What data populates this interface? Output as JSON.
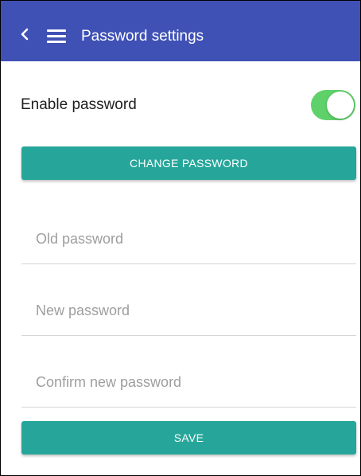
{
  "header": {
    "title": "Password settings",
    "back_icon": "chevron-left-icon",
    "menu_icon": "hamburger-menu-icon",
    "background_color": "#3f51b5"
  },
  "enable_password": {
    "label": "Enable password",
    "enabled": true,
    "toggle_color": "#5fd16a"
  },
  "change_password_button": {
    "label": "CHANGE PASSWORD"
  },
  "fields": {
    "old_password": {
      "placeholder": "Old password",
      "value": ""
    },
    "new_password": {
      "placeholder": "New password",
      "value": ""
    },
    "confirm_password": {
      "placeholder": "Confirm new password",
      "value": ""
    }
  },
  "save_button": {
    "label": "SAVE"
  },
  "accent_color": "#26a69a"
}
